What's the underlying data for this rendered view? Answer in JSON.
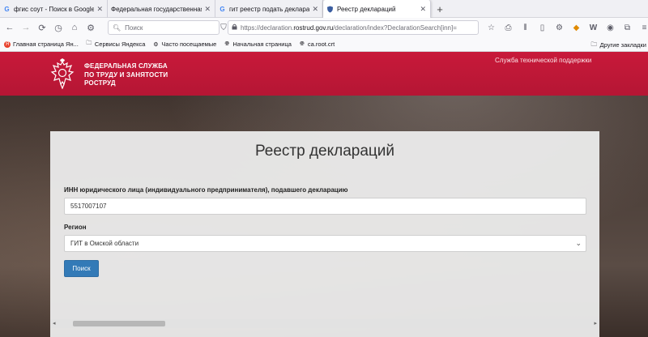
{
  "browser": {
    "tabs": [
      {
        "favicon": "G",
        "favicon_color": "#4285f4",
        "title": "фгис соут - Поиск в Google",
        "active": false
      },
      {
        "favicon": "",
        "favicon_color": "#555",
        "title": "Федеральная государственная инф",
        "active": false
      },
      {
        "favicon": "G",
        "favicon_color": "#4285f4",
        "title": "гит реестр подать декларацию",
        "active": false
      },
      {
        "favicon": "shield",
        "favicon_color": "#3a5da0",
        "title": "Реестр деклараций",
        "active": true
      }
    ],
    "search_placeholder": "Поиск",
    "url_prefix": "https://declaration.",
    "url_host": "rostrud.gov.ru",
    "url_path": "/declaration/index?DeclarationSearch[inn]=",
    "bookmarks": [
      {
        "icon": "yandex-icon",
        "label": "Главная страница Ян..."
      },
      {
        "icon": "folder-icon",
        "label": "Сервисы Яндекса"
      },
      {
        "icon": "gear-icon",
        "label": "Часто посещаемые"
      },
      {
        "icon": "globe-icon",
        "label": "Начальная страница"
      },
      {
        "icon": "globe-icon",
        "label": "ca.root.crt"
      }
    ],
    "other_bookmarks": "Другие закладки"
  },
  "site": {
    "brand_color": "#c8193a",
    "org_line1": "ФЕДЕРАЛЬНАЯ СЛУЖБА",
    "org_line2": "ПО ТРУДУ И ЗАНЯТОСТИ",
    "org_line3": "РОСТРУД",
    "support_link": "Служба технической поддержки"
  },
  "form": {
    "title": "Реестр деклараций",
    "inn_label": "ИНН юридического лица (индивидуального предпринимателя), подавшего декларацию",
    "inn_value": "5517007107",
    "region_label": "Регион",
    "region_value": "ГИТ в Омской области",
    "search_button": "Поиск",
    "button_color": "#337ab7"
  }
}
